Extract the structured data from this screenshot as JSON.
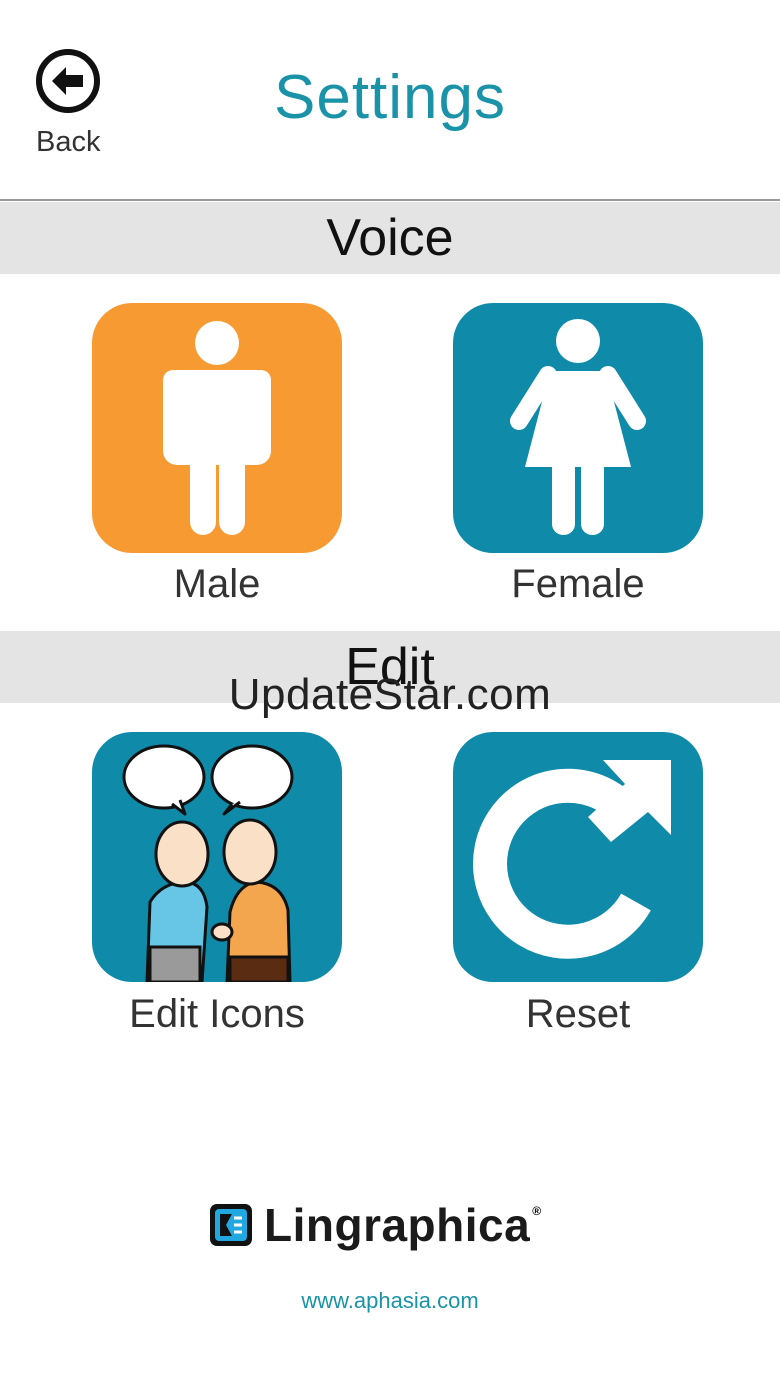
{
  "header": {
    "back_label": "Back",
    "title": "Settings"
  },
  "sections": {
    "voice": "Voice",
    "edit": "Edit"
  },
  "tiles": {
    "male": {
      "label": "Male",
      "icon": "male-figure-icon",
      "color": "#f79a32"
    },
    "female": {
      "label": "Female",
      "icon": "female-figure-icon",
      "color": "#0f8aa8"
    },
    "edit_icons": {
      "label": "Edit Icons",
      "icon": "two-people-talking-icon",
      "color": "#0f8aa8"
    },
    "reset": {
      "label": "Reset",
      "icon": "reset-arrow-icon",
      "color": "#0f8aa8"
    }
  },
  "watermark": "UpdateStar.com",
  "footer": {
    "brand": "Lingraphica",
    "url": "www.aphasia.com"
  },
  "colors": {
    "accent": "#1a93a9",
    "section_bg": "#e4e4e4"
  }
}
